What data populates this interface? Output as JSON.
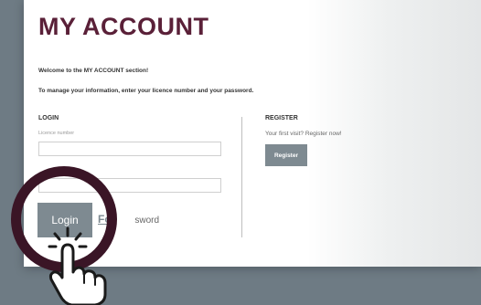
{
  "page": {
    "title": "MY ACCOUNT",
    "welcome": "Welcome to the MY ACCOUNT section!",
    "instructions": "To manage your information, enter your licence number and your password."
  },
  "login": {
    "heading": "LOGIN",
    "licence_label": "Licence number",
    "licence_value": "",
    "password_value": "",
    "login_button": "Login",
    "forgot_visible_prefix": "For",
    "forgot_visible_suffix": "sword"
  },
  "register": {
    "heading": "REGISTER",
    "prompt": "Your first visit? Register now!",
    "button": "Register"
  },
  "colors": {
    "background": "#6e7b84",
    "title": "#5a2038",
    "button": "#7e8a91",
    "highlight_ring": "#3a1526"
  },
  "icons": {
    "pointer": "pointing-hand-icon"
  }
}
